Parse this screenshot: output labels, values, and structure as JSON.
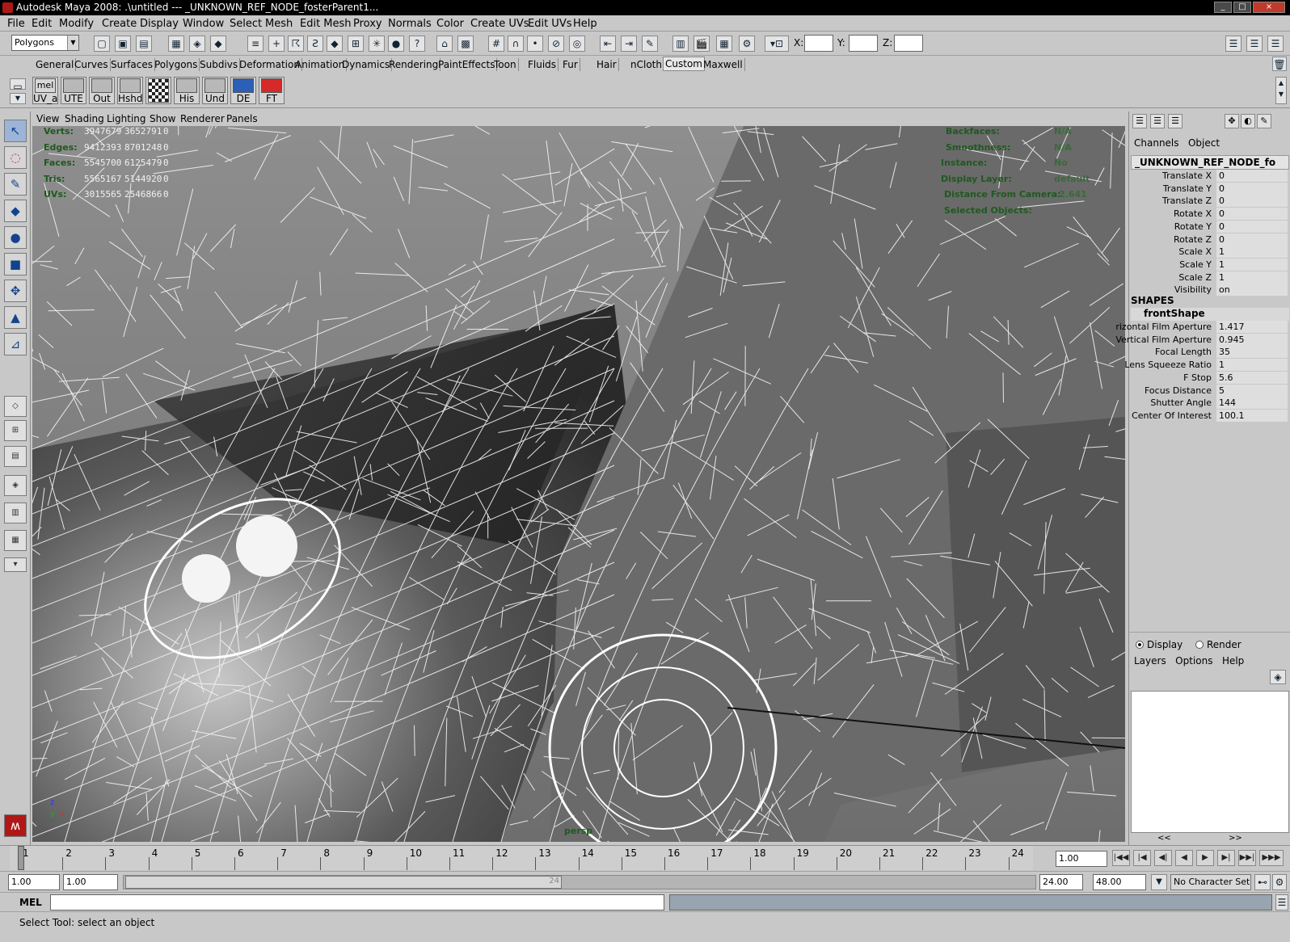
{
  "window": {
    "title": "Autodesk Maya 2008: .\\untitled   ---   _UNKNOWN_REF_NODE_fosterParent1...",
    "min": "_",
    "max": "□",
    "close": "×"
  },
  "menubar": [
    "File",
    "Edit",
    "Modify",
    "Create",
    "Display",
    "Window",
    "Select",
    "Mesh",
    "Edit Mesh",
    "Proxy",
    "Normals",
    "Color",
    "Create UVs",
    "Edit UVs",
    "Help"
  ],
  "statusline": {
    "mode": "Polygons",
    "x_label": "X:",
    "y_label": "Y:",
    "z_label": "Z:"
  },
  "shelf_tabs": {
    "items": [
      "General",
      "Curves",
      "Surfaces",
      "Polygons",
      "Subdivs",
      "Deformation",
      "Animation",
      "Dynamics",
      "Rendering",
      "PaintEffects",
      "Toon",
      "Fluids",
      "Fur",
      "Hair",
      "nCloth",
      "Custom",
      "Maxwell"
    ],
    "active": "Custom"
  },
  "shelf_buttons": [
    "UV_a",
    "UTE",
    "Out",
    "Hshd",
    "",
    "His",
    "Und",
    "DE",
    "FT"
  ],
  "shelf_mel": "mel",
  "panel_menu": [
    "View",
    "Shading",
    "Lighting",
    "Show",
    "Renderer",
    "Panels"
  ],
  "hud_left": {
    "rows": [
      {
        "label": "Verts:",
        "v1": "3947679",
        "v2": "3652791",
        "v3": "0"
      },
      {
        "label": "Edges:",
        "v1": "9412393",
        "v2": "8701248",
        "v3": "0"
      },
      {
        "label": "Faces:",
        "v1": "5545700",
        "v2": "6125479",
        "v3": "0"
      },
      {
        "label": "Tris:",
        "v1": "5565167",
        "v2": "5144920",
        "v3": "0"
      },
      {
        "label": "UVs:",
        "v1": "3015565",
        "v2": "2546866",
        "v3": "0"
      }
    ]
  },
  "hud_right": {
    "rows": [
      {
        "label": "Backfaces:",
        "value": "N/A"
      },
      {
        "label": "Smoothness:",
        "value": "N/A"
      },
      {
        "label": "Instance:",
        "value": "No"
      },
      {
        "label": "Display Layer:",
        "value": "default"
      },
      {
        "label": "Distance From Camera:",
        "value": "2.641"
      },
      {
        "label": "Selected Objects:",
        "value": ""
      }
    ]
  },
  "viewport": {
    "camera": "persp",
    "axis_z": "z",
    "axis_x": "x",
    "axis_y": "y"
  },
  "channel_box": {
    "menu": [
      "Channels",
      "Object"
    ],
    "object": "_UNKNOWN_REF_NODE_fo",
    "transform": [
      {
        "name": "Translate X",
        "value": "0"
      },
      {
        "name": "Translate Y",
        "value": "0"
      },
      {
        "name": "Translate Z",
        "value": "0"
      },
      {
        "name": "Rotate X",
        "value": "0"
      },
      {
        "name": "Rotate Y",
        "value": "0"
      },
      {
        "name": "Rotate Z",
        "value": "0"
      },
      {
        "name": "Scale X",
        "value": "1"
      },
      {
        "name": "Scale Y",
        "value": "1"
      },
      {
        "name": "Scale Z",
        "value": "1"
      },
      {
        "name": "Visibility",
        "value": "on"
      }
    ],
    "shapes_header": "SHAPES",
    "shape_name": "frontShape",
    "shape": [
      {
        "name": "rizontal Film Aperture",
        "value": "1.417"
      },
      {
        "name": "Vertical Film Aperture",
        "value": "0.945"
      },
      {
        "name": "Focal Length",
        "value": "35"
      },
      {
        "name": "Lens Squeeze Ratio",
        "value": "1"
      },
      {
        "name": "F Stop",
        "value": "5.6"
      },
      {
        "name": "Focus Distance",
        "value": "5"
      },
      {
        "name": "Shutter Angle",
        "value": "144"
      },
      {
        "name": "Center Of Interest",
        "value": "100.1"
      }
    ]
  },
  "layer_editor": {
    "display": "Display",
    "render": "Render",
    "menu": [
      "Layers",
      "Options",
      "Help"
    ],
    "scroll_left": "<<",
    "scroll_right": ">>"
  },
  "time_slider": {
    "ticks": [
      "1",
      "2",
      "3",
      "4",
      "5",
      "6",
      "7",
      "8",
      "9",
      "10",
      "11",
      "12",
      "13",
      "14",
      "15",
      "16",
      "17",
      "18",
      "19",
      "20",
      "21",
      "22",
      "23",
      "24"
    ],
    "current_frame": "1.00"
  },
  "playback": [
    "|◀◀",
    "|◀",
    "◀|",
    "◀",
    "▶",
    "▶|",
    "▶▶|",
    "▶▶▶"
  ],
  "range": {
    "start": "1.00",
    "playback_start": "1.00",
    "playback_end": "24.00",
    "end": "48.00",
    "handle_label": "24",
    "character_set": "No Character Set"
  },
  "command_line": {
    "label": "MEL"
  },
  "help_line": {
    "text": "Select Tool: select an object"
  },
  "tools": [
    "select-tool",
    "lasso-tool",
    "paint-select-tool",
    "move-tool",
    "rotate-tool",
    "scale-tool",
    "universal-manipulator",
    "soft-mod-tool",
    "show-manipulator"
  ]
}
